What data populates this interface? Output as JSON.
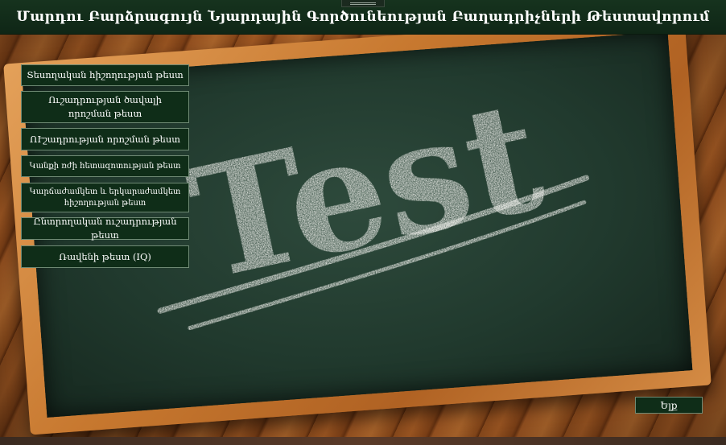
{
  "window": {
    "title": "Մարդու Բարձրագույն Նյարդային Գործունեության Բաղադրիչների Թեստավորում"
  },
  "board": {
    "text": "Test"
  },
  "menu": {
    "items": [
      {
        "label": "Տեսողական հիշողության թեստ"
      },
      {
        "label": "Ուշադրության  ծավալի որոշման  թեստ"
      },
      {
        "label": "ՈՒշադրության որոշման թեստ"
      },
      {
        "label": "Կանքի ռժի հետազոտության թեստ"
      },
      {
        "label": "Կարճաժամկետ և երկարաժամկետ հիշողության թեստ"
      },
      {
        "label": "Ընտրողական ուշադրության թեստ"
      },
      {
        "label": "Ռավենի թեստ (IQ)"
      }
    ]
  },
  "footer": {
    "exit_label": "Ելք"
  }
}
